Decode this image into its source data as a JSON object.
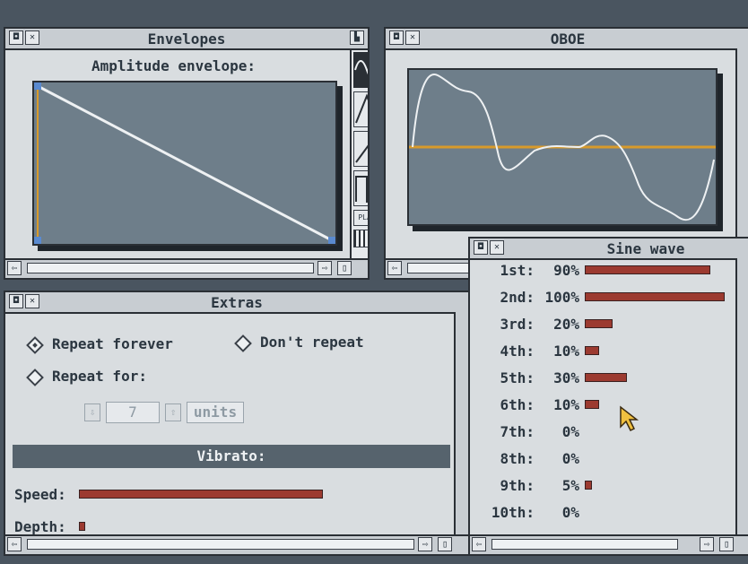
{
  "envelopes": {
    "title": "Envelopes",
    "subtitle": "Amplitude envelope:",
    "waveforms": [
      "sine-wave-icon",
      "triangle-wave-icon",
      "sawtooth-wave-icon",
      "square-wave-icon"
    ],
    "play_label": "PLAY"
  },
  "oboe": {
    "title": "OBOE"
  },
  "sine": {
    "title": "Sine wave",
    "harmonics": [
      {
        "name": "1st:",
        "pct": "90%",
        "value": 90
      },
      {
        "name": "2nd:",
        "pct": "100%",
        "value": 100
      },
      {
        "name": "3rd:",
        "pct": "20%",
        "value": 20
      },
      {
        "name": "4th:",
        "pct": "10%",
        "value": 10
      },
      {
        "name": "5th:",
        "pct": "30%",
        "value": 30
      },
      {
        "name": "6th:",
        "pct": "10%",
        "value": 10
      },
      {
        "name": "7th:",
        "pct": "0%",
        "value": 0
      },
      {
        "name": "8th:",
        "pct": "0%",
        "value": 0
      },
      {
        "name": "9th:",
        "pct": "5%",
        "value": 5
      },
      {
        "name": "10th:",
        "pct": "0%",
        "value": 0
      }
    ]
  },
  "extras": {
    "title": "Extras",
    "repeat_forever": "Repeat forever",
    "dont_repeat": "Don't repeat",
    "repeat_for": "Repeat for:",
    "count": "7",
    "units": "units",
    "vibrato_title": "Vibrato:",
    "speed_label": "Speed:",
    "depth_label": "Depth:",
    "speed_level": 0.82,
    "depth_level": 0.02
  },
  "colors": {
    "bar": "#9c3a30",
    "baseline": "#d89a2a",
    "wave": "#eef1f3",
    "plot": "#6e7e8a"
  }
}
